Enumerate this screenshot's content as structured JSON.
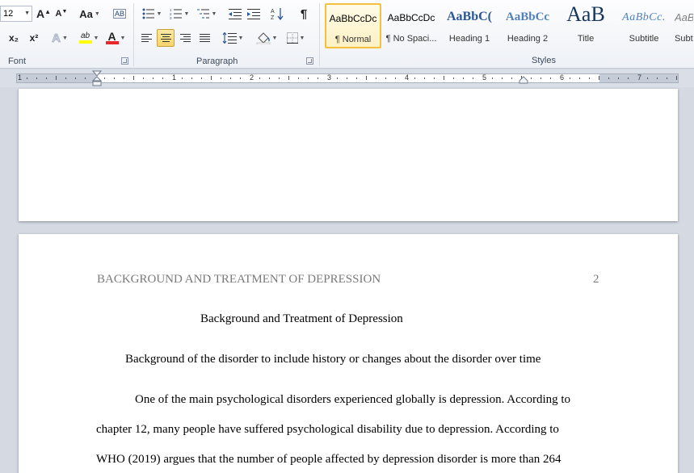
{
  "ribbon": {
    "font_group": {
      "label": "Font",
      "font_size": "12",
      "grow_font": "A",
      "shrink_font": "A",
      "change_case": "Aa",
      "clear_format": "AB",
      "subscript": "x₂",
      "superscript": "x²",
      "text_effects": "A",
      "highlight": "ab",
      "font_color": "A"
    },
    "paragraph_group": {
      "label": "Paragraph",
      "pilcrow": "¶"
    },
    "styles_group": {
      "label": "Styles",
      "items": [
        {
          "sample": "AaBbCcDc",
          "name": "¶ Normal",
          "selected": true
        },
        {
          "sample": "AaBbCcDc",
          "name": "¶ No Spaci..."
        },
        {
          "sample": "AaBbC(",
          "name": "Heading 1"
        },
        {
          "sample": "AaBbCc",
          "name": "Heading 2"
        },
        {
          "sample": "AaB",
          "name": "Title"
        },
        {
          "sample": "AaBbCc.",
          "name": "Subtitle"
        },
        {
          "sample": "AaBl",
          "name": "Subt"
        }
      ]
    },
    "colors": {
      "highlight": "#ffff00",
      "font_color": "#e8262b",
      "heading_blue": "#2a5597"
    }
  },
  "ruler": {
    "numbers": [
      "1",
      "1",
      "2",
      "3",
      "4",
      "5",
      "6",
      "7"
    ]
  },
  "document": {
    "page2": {
      "header_title": "BACKGROUND AND TREATMENT OF DEPRESSION",
      "page_number": "2",
      "title": "Background and Treatment of Depression",
      "subheading": "Background of the disorder to include history or changes about the disorder over time",
      "para_lines": [
        "One of the main psychological disorders experienced globally is depression. According to",
        "chapter 12, many people have suffered psychological disability due to depression. According to",
        "WHO (2019) argues that the number of people affected by depression disorder is more than 264"
      ]
    }
  }
}
